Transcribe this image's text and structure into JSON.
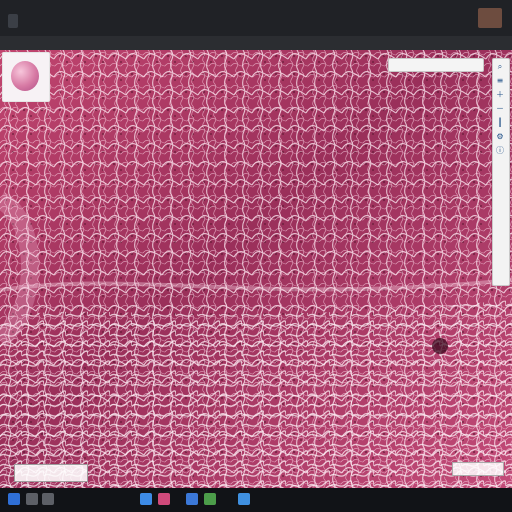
{
  "window": {
    "title": "",
    "toolbar_text": "",
    "coord_box": ""
  },
  "viewer": {
    "status_right": "",
    "scale_label": ""
  },
  "taskbar": {
    "clock": "",
    "date": ""
  },
  "icons": {
    "thumb": "thumbnail-icon",
    "search": "search-icon",
    "layers": "layers-icon",
    "zoom_in": "zoom-in-icon",
    "zoom_out": "zoom-out-icon",
    "ruler": "ruler-icon",
    "settings": "gear-icon",
    "info": "info-icon"
  }
}
